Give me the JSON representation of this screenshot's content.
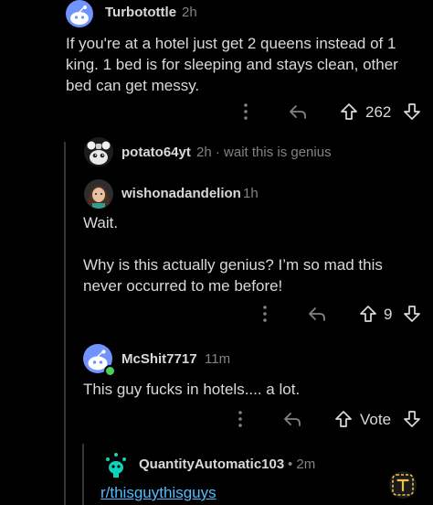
{
  "comments": [
    {
      "username": "Turbotottle",
      "time": "2h",
      "body": "If you're at a hotel just get 2 queens instead of 1 king. 1 bed is for sleeping and stays clean, other bed can get messy.",
      "score": "262"
    },
    {
      "username": "potato64yt",
      "meta": "2h · wait this is genius"
    },
    {
      "username": "wishonadandelion",
      "time": "1h",
      "body_line1": "Wait.",
      "body_line2": "Why is this actually genius? I’m so mad this never occurred to me before!",
      "score": "9"
    },
    {
      "username": "McShit7717",
      "time": "11m",
      "body": "This guy fucks in hotels.... a lot.",
      "score": "Vote"
    },
    {
      "username": "QuantityAutomatic103",
      "time": "• 2m",
      "link": "r/thisguythisguys"
    }
  ],
  "icons": {
    "more": "more-vertical-icon",
    "reply": "reply-arrow-icon",
    "upvote": "upvote-arrow-icon",
    "downvote": "downvote-arrow-icon",
    "fab": "text-format-icon"
  },
  "colors": {
    "background": "#000000",
    "text": "#d7dadc",
    "muted": "#818384",
    "link": "#4fbcff",
    "online": "#46d160",
    "thread": "#343536"
  }
}
